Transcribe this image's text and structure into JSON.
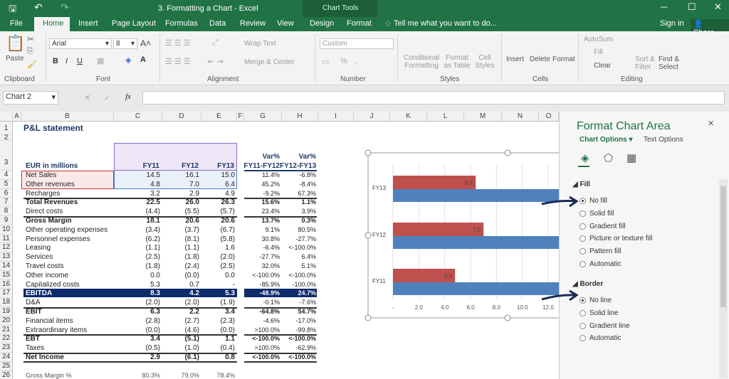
{
  "window": {
    "title": "3. Formatting a Chart - Excel",
    "context_group": "Chart Tools",
    "sign_in": "Sign in",
    "share": "Share"
  },
  "tabs": [
    "File",
    "Home",
    "Insert",
    "Page Layout",
    "Formulas",
    "Data",
    "Review",
    "View",
    "Design",
    "Format"
  ],
  "active_tab": "Home",
  "tell_me": "Tell me what you want to do...",
  "ribbon": {
    "clipboard": {
      "paste": "Paste",
      "label": "Clipboard"
    },
    "font": {
      "name": "Arial",
      "size": "8",
      "bold": "B",
      "italic": "I",
      "underline": "U",
      "label": "Font"
    },
    "alignment": {
      "wrap": "Wrap Text",
      "merge": "Merge & Center",
      "label": "Alignment"
    },
    "number": {
      "format": "Custom",
      "percent": "%",
      "comma": ",",
      "label": "Number"
    },
    "styles": {
      "conditional": "Conditional Formatting",
      "format_table": "Format as Table",
      "cell_styles": "Cell Styles",
      "label": "Styles"
    },
    "cells": {
      "insert": "Insert",
      "delete": "Delete",
      "format": "Format",
      "label": "Cells"
    },
    "editing": {
      "autosum": "AutoSum",
      "fill": "Fill",
      "clear": "Clear",
      "sort": "Sort & Filter",
      "find": "Find & Select",
      "label": "Editing"
    }
  },
  "formula_bar": {
    "name_box": "Chart 2",
    "fx": "fx",
    "value": ""
  },
  "columns": [
    "A",
    "B",
    "C",
    "D",
    "E",
    "F",
    "G",
    "H",
    "I",
    "J",
    "K",
    "L",
    "M",
    "N",
    "O"
  ],
  "sheet": {
    "title": "P&L statement",
    "header": {
      "label": "EUR in millions",
      "c": "FY11",
      "d": "FY12",
      "e": "FY13",
      "g1": "Var%",
      "g2": "FY11-FY12",
      "h1": "Var%",
      "h2": "FY12-FY13"
    },
    "rows": [
      {
        "n": 4,
        "label": "Net Sales",
        "c": "14.5",
        "d": "16.1",
        "e": "15.0",
        "g": "11.4%",
        "h": "-6.8%"
      },
      {
        "n": 5,
        "label": "Other revenues",
        "c": "4.8",
        "d": "7.0",
        "e": "6.4",
        "g": "45.2%",
        "h": "-8.4%"
      },
      {
        "n": 6,
        "label": "Recharges",
        "c": "3.2",
        "d": "2.9",
        "e": "4.9",
        "g": "-9.2%",
        "h": "67.3%"
      },
      {
        "n": 7,
        "label": "Total Revenues",
        "c": "22.5",
        "d": "26.0",
        "e": "26.3",
        "g": "15.6%",
        "h": "1.1%",
        "bold": true,
        "top": true
      },
      {
        "n": 8,
        "label": "Direct costs",
        "c": "(4.4)",
        "d": "(5.5)",
        "e": "(5.7)",
        "g": "23.4%",
        "h": "3.9%"
      },
      {
        "n": 9,
        "label": "Gross Margin",
        "c": "18.1",
        "d": "20.6",
        "e": "20.6",
        "g": "13.7%",
        "h": "0.3%",
        "bold": true,
        "top": true
      },
      {
        "n": 10,
        "label": "Other operating expenses",
        "c": "(3.4)",
        "d": "(3.7)",
        "e": "(6.7)",
        "g": "9.1%",
        "h": "80.5%"
      },
      {
        "n": 11,
        "label": "Personnel expenses",
        "c": "(6.2)",
        "d": "(8.1)",
        "e": "(5.8)",
        "g": "30.8%",
        "h": "-27.7%"
      },
      {
        "n": 12,
        "label": "Leasing",
        "c": "(1.1)",
        "d": "(1.1)",
        "e": "1.6",
        "g": "-6.4%",
        "h": "<-100.0%"
      },
      {
        "n": 13,
        "label": "Services",
        "c": "(2.5)",
        "d": "(1.8)",
        "e": "(2.0)",
        "g": "-27.7%",
        "h": "6.4%"
      },
      {
        "n": 14,
        "label": "Travel costs",
        "c": "(1.8)",
        "d": "(2.4)",
        "e": "(2.5)",
        "g": "32.0%",
        "h": "5.1%"
      },
      {
        "n": 15,
        "label": "Other income",
        "c": "0.0",
        "d": "(0.0)",
        "e": "0.0",
        "g": "<-100.0%",
        "h": "<-100.0%"
      },
      {
        "n": 16,
        "label": "Capitalized costs",
        "c": "5.3",
        "d": "0.7",
        "e": "-",
        "g": "-85.9%",
        "h": "-100.0%"
      },
      {
        "n": 17,
        "label": "EBITDA",
        "c": "8.3",
        "d": "4.2",
        "e": "5.3",
        "g": "-48.9%",
        "h": "24.7%",
        "highlight": true
      },
      {
        "n": 18,
        "label": "D&A",
        "c": "(2.0)",
        "d": "(2.0)",
        "e": "(1.9)",
        "g": "-0.1%",
        "h": "-7.6%"
      },
      {
        "n": 19,
        "label": "EBIT",
        "c": "6.3",
        "d": "2.2",
        "e": "3.4",
        "g": "-64.8%",
        "h": "54.7%",
        "bold": true,
        "top": true
      },
      {
        "n": 20,
        "label": "Financial items",
        "c": "(2.8)",
        "d": "(2.7)",
        "e": "(2.3)",
        "g": "-4.6%",
        "h": "-17.0%"
      },
      {
        "n": 21,
        "label": "Extraordinary items",
        "c": "(0.0)",
        "d": "(4.6)",
        "e": "(0.0)",
        "g": ">100.0%",
        "h": "-99.8%"
      },
      {
        "n": 22,
        "label": "EBT",
        "c": "3.4",
        "d": "(5.1)",
        "e": "1.1",
        "g": "<-100.0%",
        "h": "<-100.0%",
        "bold": true,
        "top": true
      },
      {
        "n": 23,
        "label": "Taxes",
        "c": "(0.5)",
        "d": "(1.0)",
        "e": "(0.4)",
        "g": ">100.0%",
        "h": "-62.9%"
      },
      {
        "n": 24,
        "label": "Net Income",
        "c": "2.9",
        "d": "(6.1)",
        "e": "0.8",
        "g": "<-100.0%",
        "h": "<-100.0%",
        "bold": true,
        "top": true,
        "bottom": true
      },
      {
        "n": 25,
        "label": "",
        "c": "",
        "d": "",
        "e": "",
        "g": "",
        "h": ""
      },
      {
        "n": 26,
        "label": "Gross Margin %",
        "c": "80.3%",
        "d": "79.0%",
        "e": "78.4%",
        "g": "",
        "h": ""
      }
    ]
  },
  "chart_data": {
    "type": "bar",
    "orientation": "horizontal",
    "categories": [
      "FY11",
      "FY12",
      "FY13"
    ],
    "series": [
      {
        "values": [
          4.8,
          7.0,
          6.4
        ],
        "color": "#c0504d",
        "data_labels": [
          "4.8",
          "7.0",
          "6.4"
        ]
      },
      {
        "values": [
          14.5,
          16.1,
          15.0
        ],
        "color": "#4f81bd"
      }
    ],
    "xticks": [
      "-",
      "2.0",
      "4.0",
      "6.0",
      "8.0",
      "10.0",
      "12.0"
    ],
    "xlim": [
      0,
      12.0
    ],
    "grid": true
  },
  "pane": {
    "title": "Format Chart Area",
    "tabs": [
      "Chart Options",
      "Text Options"
    ],
    "fill": {
      "header": "Fill",
      "options": [
        "No fill",
        "Solid fill",
        "Gradient fill",
        "Picture or texture fill",
        "Pattern fill",
        "Automatic"
      ],
      "selected": 0
    },
    "border": {
      "header": "Border",
      "options": [
        "No line",
        "Solid line",
        "Gradient line",
        "Automatic"
      ],
      "selected": 0
    }
  }
}
